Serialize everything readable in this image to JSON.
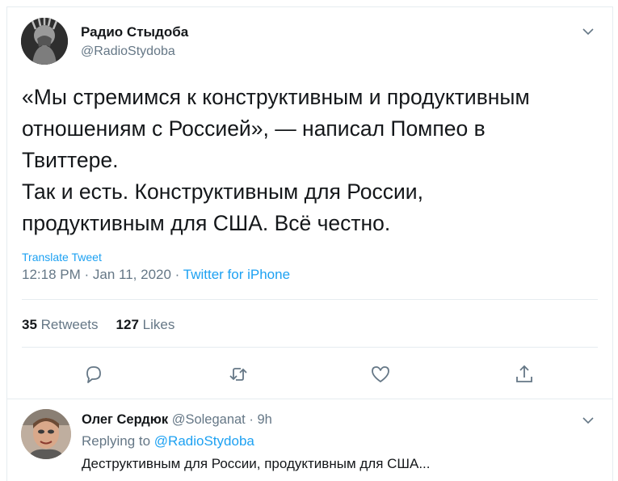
{
  "tweet": {
    "author_name": "Радио Стыдоба",
    "author_handle": "@RadioStydoba",
    "text_lines": [
      "«Мы стремимся к конструктивным и продуктивным",
      "отношениям с Россией», — написал Помпео в",
      "Твиттере.",
      "Так и есть. Конструктивным для России,",
      "продуктивным для США. Всё честно."
    ],
    "translate_label": "Translate Tweet",
    "time": "12:18 PM",
    "date": "Jan 11, 2020",
    "source": "Twitter for iPhone",
    "retweets_count": "35",
    "retweets_label": "Retweets",
    "likes_count": "127",
    "likes_label": "Likes"
  },
  "actions": {
    "icons": [
      "reply-icon",
      "retweet-icon",
      "like-icon",
      "share-icon"
    ]
  },
  "reply": {
    "author_name": "Олег Сердюк",
    "author_handle": "@Soleganat",
    "age": "9h",
    "replying_prefix": "Replying to",
    "replying_to": "@RadioStydoba",
    "text": "Деструктивным для России, продуктивным для США..."
  },
  "colors": {
    "text": "#14171a",
    "secondary": "#657786",
    "link": "#1da1f2",
    "border": "#e6ecf0"
  }
}
